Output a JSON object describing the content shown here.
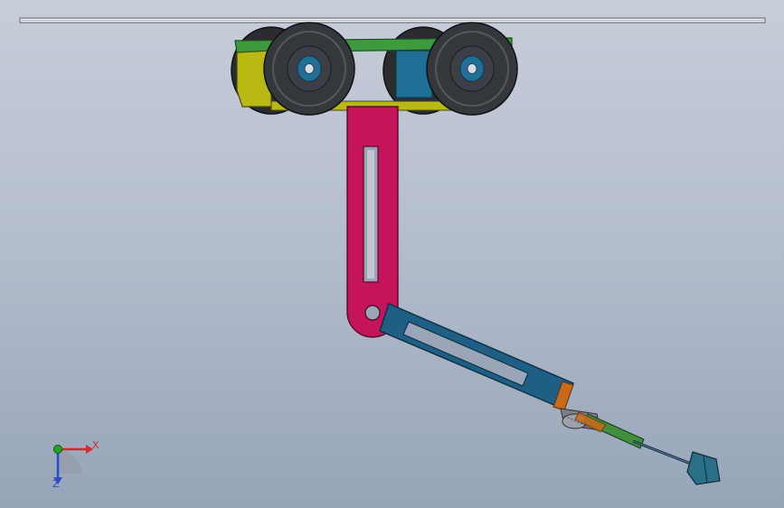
{
  "viewport": {
    "background_top": "#c7ceda",
    "background_bottom": "#97a4b8"
  },
  "colors": {
    "rail": "#e8e8e8",
    "carriage_plate_green": "#3d9a3d",
    "carriage_body_yellow": "#b9b915",
    "wheel_tire": "#2a2c30",
    "wheel_hub": "#1f6f97",
    "hanger_magenta": "#c4145a",
    "arm_blue": "#1f5f86",
    "bracket_orange": "#c86a1a",
    "gear_gray": "#8a8f98",
    "plate_green": "#3f8f3f",
    "effector_teal": "#2a6f86"
  },
  "triad": {
    "x_label": "X",
    "z_label": "Z",
    "x_color": "#d22a2a",
    "y_color": "#1fa51f",
    "z_color": "#2b4cc7"
  }
}
